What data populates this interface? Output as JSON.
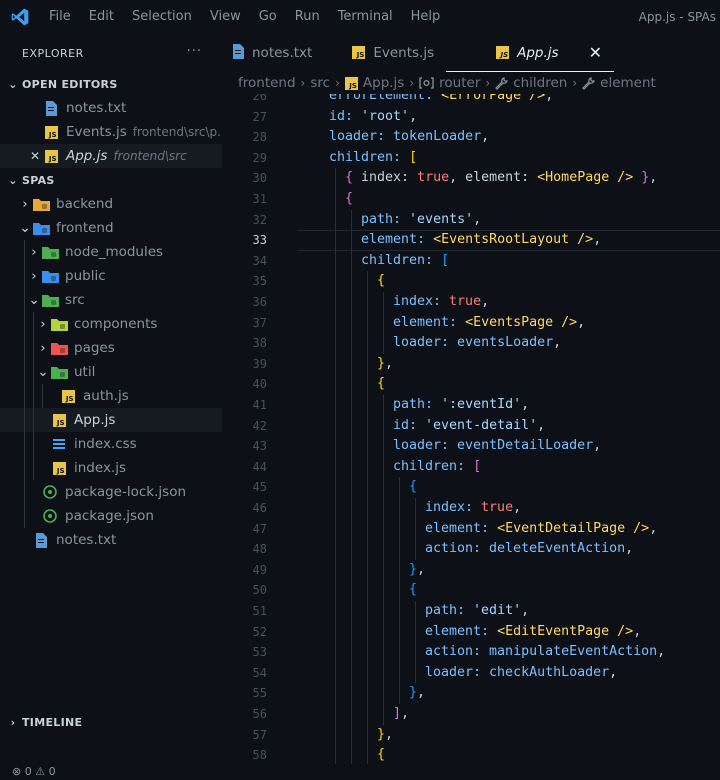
{
  "menu": [
    "File",
    "Edit",
    "Selection",
    "View",
    "Go",
    "Run",
    "Terminal",
    "Help"
  ],
  "window_title": "App.js - SPAs",
  "explorer": {
    "title": "EXPLORER",
    "more": "···",
    "open_editors_label": "OPEN EDITORS",
    "open_editors": [
      {
        "name": "notes.txt",
        "desc": "",
        "type": "txt"
      },
      {
        "name": "Events.js",
        "desc": "frontend\\src\\p...",
        "type": "js"
      },
      {
        "name": "App.js",
        "desc": "frontend\\src",
        "type": "js",
        "close": "✕",
        "active": true
      }
    ],
    "workspace_label": "SPAS",
    "tree": [
      {
        "name": "backend",
        "depth": 1,
        "chev": "›",
        "type": "folder-yellow"
      },
      {
        "name": "frontend",
        "depth": 1,
        "chev": "⌄",
        "type": "folder-blue"
      },
      {
        "name": "node_modules",
        "depth": 2,
        "chev": "›",
        "type": "folder-green"
      },
      {
        "name": "public",
        "depth": 2,
        "chev": "›",
        "type": "folder-blue"
      },
      {
        "name": "src",
        "depth": 2,
        "chev": "⌄",
        "type": "folder-green"
      },
      {
        "name": "components",
        "depth": 3,
        "chev": "›",
        "type": "folder-yellowgreen"
      },
      {
        "name": "pages",
        "depth": 3,
        "chev": "›",
        "type": "folder-red"
      },
      {
        "name": "util",
        "depth": 3,
        "chev": "⌄",
        "type": "folder-green"
      },
      {
        "name": "auth.js",
        "depth": 4,
        "chev": "",
        "type": "js"
      },
      {
        "name": "App.js",
        "depth": 3,
        "chev": "",
        "type": "js",
        "selected": true
      },
      {
        "name": "index.css",
        "depth": 3,
        "chev": "",
        "type": "css"
      },
      {
        "name": "index.js",
        "depth": 3,
        "chev": "",
        "type": "js"
      },
      {
        "name": "package-lock.json",
        "depth": 2,
        "chev": "",
        "type": "json"
      },
      {
        "name": "package.json",
        "depth": 2,
        "chev": "",
        "type": "json"
      },
      {
        "name": "notes.txt",
        "depth": 1,
        "chev": "",
        "type": "txt"
      }
    ],
    "timeline_label": "TIMELINE"
  },
  "status": "⊗ 0 ⚠ 0",
  "tabs": [
    {
      "label": "notes.txt",
      "type": "txt"
    },
    {
      "label": "Events.js",
      "type": "js"
    },
    {
      "label": "App.js",
      "type": "js",
      "active": true,
      "close": "✕"
    }
  ],
  "breadcrumb": [
    "frontend",
    "src",
    "App.js",
    "router",
    "children",
    "element"
  ],
  "editor": {
    "first_line": 26,
    "current_line": 33,
    "lines": [
      {
        "indent": 4,
        "tokens": [
          [
            "errorElement: ",
            "p"
          ],
          [
            "<",
            "c"
          ],
          [
            "ErrorPage",
            "c"
          ],
          [
            " />",
            "c"
          ],
          [
            ",",
            "p"
          ]
        ]
      },
      {
        "indent": 4,
        "tokens": [
          [
            "id: ",
            "p"
          ],
          [
            "'root'",
            "s"
          ],
          [
            ",",
            "p"
          ]
        ]
      },
      {
        "indent": 4,
        "tokens": [
          [
            "loader: ",
            "p"
          ],
          [
            "tokenLoader",
            "p"
          ],
          [
            ",",
            "p"
          ]
        ]
      },
      {
        "indent": 4,
        "tokens": [
          [
            "children: ",
            "p"
          ],
          [
            "[",
            "b1"
          ]
        ]
      },
      {
        "indent": 6,
        "tokens": [
          [
            "{",
            "b2"
          ],
          [
            " index: ",
            "p"
          ],
          [
            "true",
            "p"
          ],
          [
            ", element: ",
            "p"
          ],
          [
            "<",
            "c"
          ],
          [
            "HomePage",
            "c"
          ],
          [
            " />",
            "c"
          ],
          [
            " ",
            "p"
          ],
          [
            "}",
            "b2"
          ],
          [
            ",",
            "p"
          ]
        ]
      },
      {
        "indent": 6,
        "tokens": [
          [
            "{",
            "b2"
          ]
        ]
      },
      {
        "indent": 8,
        "tokens": [
          [
            "path: ",
            "p"
          ],
          [
            "'events'",
            "s"
          ],
          [
            ",",
            "p"
          ]
        ]
      },
      {
        "indent": 8,
        "tokens": [
          [
            "element: ",
            "p"
          ],
          [
            "<",
            "c"
          ],
          [
            "EventsRootLayout",
            "c"
          ],
          [
            " />",
            "c"
          ],
          [
            ",",
            "p"
          ]
        ]
      },
      {
        "indent": 8,
        "tokens": [
          [
            "children: ",
            "p"
          ],
          [
            "[",
            "b3"
          ]
        ]
      },
      {
        "indent": 10,
        "tokens": [
          [
            "{",
            "b1"
          ]
        ]
      },
      {
        "indent": 12,
        "tokens": [
          [
            "index: ",
            "p"
          ],
          [
            "true",
            "p"
          ],
          [
            ",",
            "p"
          ]
        ]
      },
      {
        "indent": 12,
        "tokens": [
          [
            "element: ",
            "p"
          ],
          [
            "<",
            "c"
          ],
          [
            "EventsPage",
            "c"
          ],
          [
            " />",
            "c"
          ],
          [
            ",",
            "p"
          ]
        ]
      },
      {
        "indent": 12,
        "tokens": [
          [
            "loader: ",
            "p"
          ],
          [
            "eventsLoader",
            "p"
          ],
          [
            ",",
            "p"
          ]
        ]
      },
      {
        "indent": 10,
        "tokens": [
          [
            "}",
            "b1"
          ],
          [
            ",",
            "p"
          ]
        ]
      },
      {
        "indent": 10,
        "tokens": [
          [
            "{",
            "b1"
          ]
        ]
      },
      {
        "indent": 12,
        "tokens": [
          [
            "path: ",
            "p"
          ],
          [
            "':eventId'",
            "s"
          ],
          [
            ",",
            "p"
          ]
        ]
      },
      {
        "indent": 12,
        "tokens": [
          [
            "id: ",
            "p"
          ],
          [
            "'event-detail'",
            "s"
          ],
          [
            ",",
            "p"
          ]
        ]
      },
      {
        "indent": 12,
        "tokens": [
          [
            "loader: ",
            "p"
          ],
          [
            "eventDetailLoader",
            "p"
          ],
          [
            ",",
            "p"
          ]
        ]
      },
      {
        "indent": 12,
        "tokens": [
          [
            "children: ",
            "p"
          ],
          [
            "[",
            "b2"
          ]
        ]
      },
      {
        "indent": 14,
        "tokens": [
          [
            "{",
            "b3"
          ]
        ]
      },
      {
        "indent": 16,
        "tokens": [
          [
            "index: ",
            "p"
          ],
          [
            "true",
            "bool"
          ],
          [
            ",",
            "p"
          ]
        ]
      },
      {
        "indent": 16,
        "tokens": [
          [
            "element: ",
            "p"
          ],
          [
            "<",
            "c"
          ],
          [
            "EventDetailPage",
            "c"
          ],
          [
            " />",
            "c"
          ],
          [
            ",",
            "p"
          ]
        ]
      },
      {
        "indent": 16,
        "tokens": [
          [
            "action: ",
            "p"
          ],
          [
            "deleteEventAction",
            "p"
          ],
          [
            ",",
            "p"
          ]
        ]
      },
      {
        "indent": 14,
        "tokens": [
          [
            "}",
            "b3"
          ],
          [
            ",",
            "p"
          ]
        ]
      },
      {
        "indent": 14,
        "tokens": [
          [
            "{",
            "b3"
          ]
        ]
      },
      {
        "indent": 16,
        "tokens": [
          [
            "path: ",
            "p"
          ],
          [
            "'edit'",
            "s"
          ],
          [
            ",",
            "p"
          ]
        ]
      },
      {
        "indent": 16,
        "tokens": [
          [
            "element: ",
            "p"
          ],
          [
            "<",
            "c"
          ],
          [
            "EditEventPage",
            "c"
          ],
          [
            " />",
            "c"
          ],
          [
            ",",
            "p"
          ]
        ]
      },
      {
        "indent": 16,
        "tokens": [
          [
            "action: ",
            "p"
          ],
          [
            "manipulateEventAction",
            "p"
          ],
          [
            ",",
            "p"
          ]
        ]
      },
      {
        "indent": 16,
        "tokens": [
          [
            "loader: ",
            "p"
          ],
          [
            "checkAuthLoader",
            "p"
          ],
          [
            ",",
            "p"
          ]
        ]
      },
      {
        "indent": 14,
        "tokens": [
          [
            "}",
            "b3"
          ],
          [
            ",",
            "p"
          ]
        ]
      },
      {
        "indent": 12,
        "tokens": [
          [
            "]",
            "b2"
          ],
          [
            ",",
            "p"
          ]
        ]
      },
      {
        "indent": 10,
        "tokens": [
          [
            "}",
            "b1"
          ],
          [
            ",",
            "p"
          ]
        ]
      },
      {
        "indent": 10,
        "tokens": [
          [
            "{",
            "b1"
          ]
        ]
      }
    ]
  },
  "colors": {
    "background": "#0d1117",
    "keyword": "#79c0ff",
    "string": "#a5d6ff",
    "component": "#ffd866",
    "js_icon": "#e8c547"
  }
}
